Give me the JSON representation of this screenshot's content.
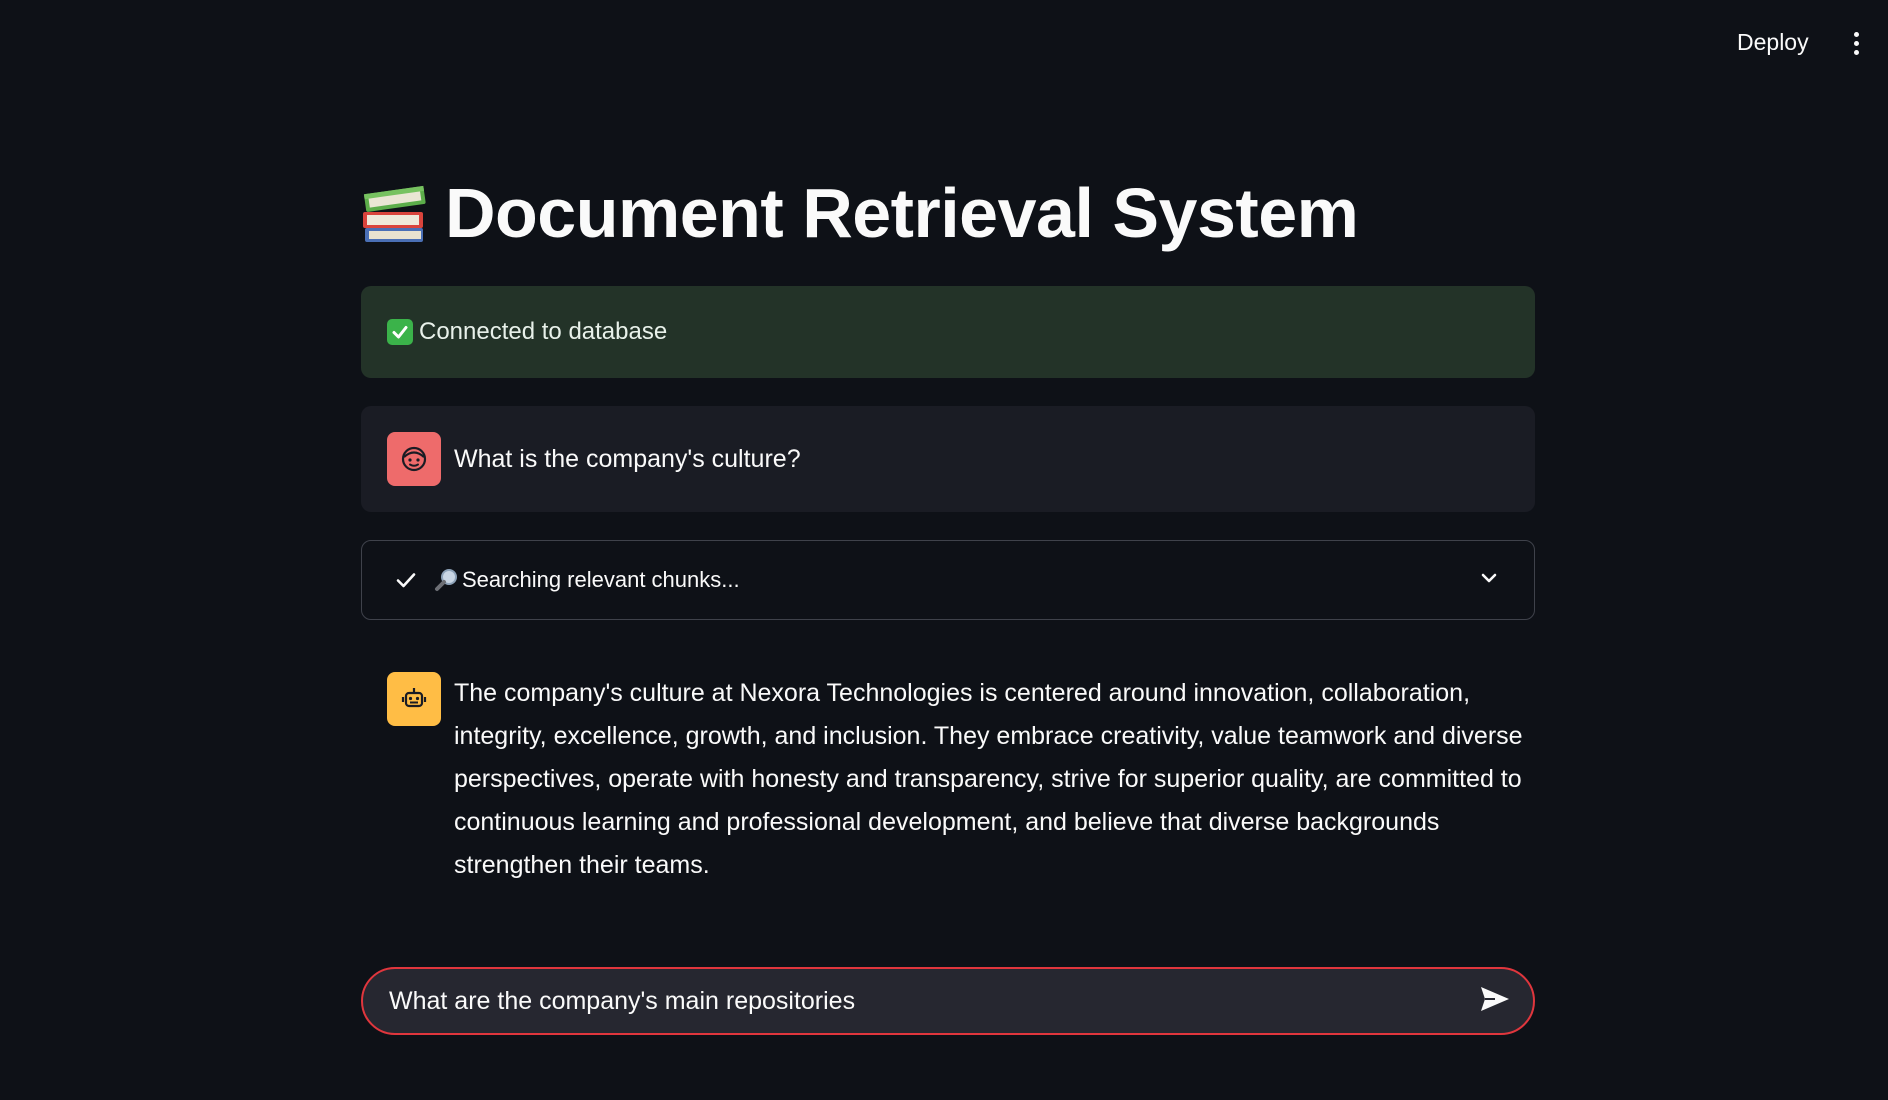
{
  "header": {
    "deploy_label": "Deploy",
    "menu_icon": "vertical-ellipsis-icon"
  },
  "page": {
    "title_icon": "books-icon",
    "title": "Document Retrieval System"
  },
  "status": {
    "icon": "check-mark-button-icon",
    "text": "Connected to database",
    "color": "#233328"
  },
  "chat": {
    "user_message": {
      "avatar_icon": "user-face-icon",
      "text": "What is the company's culture?"
    },
    "expander": {
      "state_icon": "checkmark-icon",
      "search_icon": "magnifier-icon",
      "label": "Searching relevant chunks...",
      "toggle_icon": "chevron-down-icon"
    },
    "assistant_message": {
      "avatar_icon": "robot-icon",
      "text": "The company's culture at Nexora Technologies is centered around innovation, collaboration, integrity, excellence, growth, and inclusion. They embrace creativity, value teamwork and diverse perspectives, operate with honesty and transparency, strive for superior quality, are committed to continuous learning and professional development, and believe that diverse backgrounds strengthen their teams."
    }
  },
  "input": {
    "value": "What are the company's main repositories",
    "send_icon": "send-icon"
  },
  "colors": {
    "background": "#0e1117",
    "user_avatar": "#ee6b6b",
    "bot_avatar": "#ffbd45",
    "input_border": "#e0363d"
  }
}
